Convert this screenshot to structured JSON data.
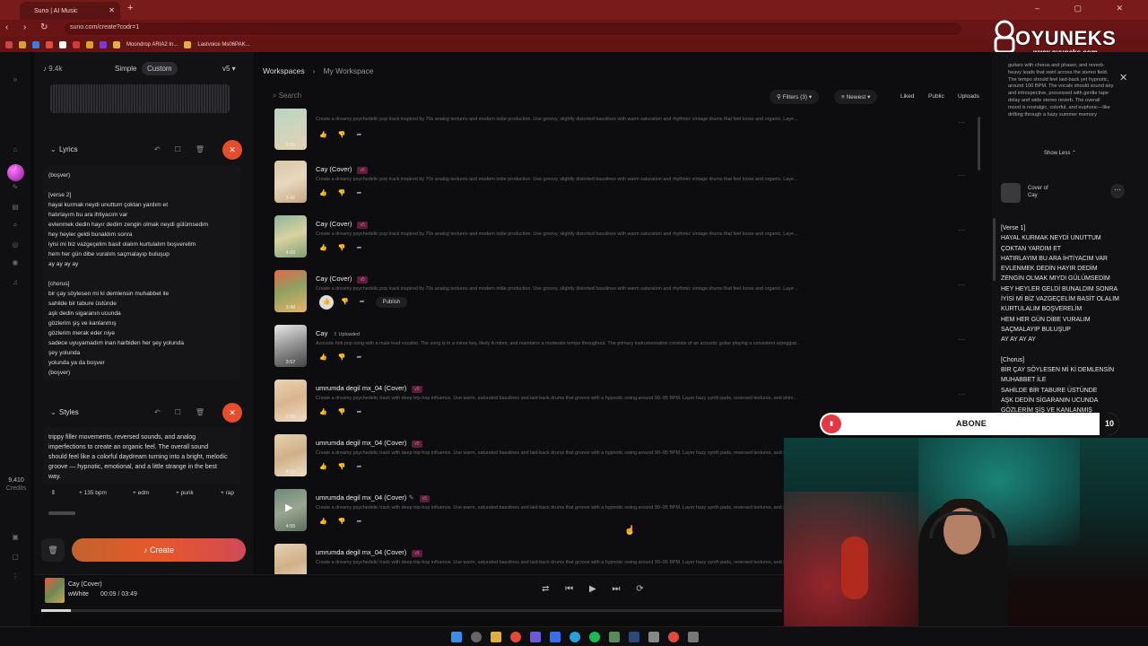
{
  "browser": {
    "tab_title": "Suno | AI Music",
    "url": "suno.com/create?codr=1",
    "bookmarks": [
      "Moondrop ARIA2 In...",
      "Lastvoice Ms06PAK..."
    ]
  },
  "overlay": {
    "brand": "OYUNEKS",
    "site": "www.oyuneks.com",
    "subscribe": "ABONE",
    "subscribe_count": "10"
  },
  "rail": {
    "credits_value": "9,410",
    "credits_label": "Credits"
  },
  "create_panel": {
    "likes": "9.4k",
    "mode_simple": "Simple",
    "mode_custom": "Custom",
    "version": "v5",
    "lyrics_label": "Lyrics",
    "lyrics_text": "(boşver)\n\n[verse 2]\nhayal kurmak neydi unuttum çoktan yardım et\nhatırlayım bu ara ihtiyacım var\nevlenmek dedin hayır dedim zengin olmak neydi gülümsedim\nhey heyler geldi bunaldım sonra\niyisi mi biz vazgeçelim basit olalım kurtulalım boşverelim\nhem her gün dibe vuralım saçmalayıp buluşup\nay ay ay ay\n\n[chorus]\nbir çay söylesen mi ki demlensin muhabbet ile\nsahilde bir tabure üstünde\naşk dedin sigaranın ucunda\ngözlerim şiş ve kanlanmış\ngözlerim merak eder niye\nsadece uyuyamadım inan harbiden her şey yolunda\nşey yolunda\nyolunda ya da boşver\n(boşver)",
    "styles_label": "Styles",
    "styles_text": "trippy filler movements, reversed sounds, and analog imperfections to create an organic feel. The overall sound should feel like a colorful daydream turning into a bright, melodic groove — hypnotic, emotional, and a little strange in the best way.",
    "tags": [
      "135 bpm",
      "edm",
      "punk",
      "rap"
    ],
    "create_label": "Create"
  },
  "workspace": {
    "crumb_root": "Workspaces",
    "crumb_current": "My Workspace",
    "search_placeholder": "Search",
    "filters": "Filters (3)",
    "sort": "Newest",
    "liked": "Liked",
    "public": "Public",
    "uploads": "Uploads",
    "rows": [
      {
        "title": "",
        "badge": "",
        "desc": "Create a dreamy psychedelic pop track inspired by 70s analog textures and modern indie production. Use groovy, slightly distorted basslines with warm saturation and rhythmic vintage drums that feel loose and organic. Laye...",
        "duration": "3:35"
      },
      {
        "title": "Cay (Cover)",
        "badge": "v5",
        "desc": "Create a dreamy psychedelic pop track inspired by 70s analog textures and modern indie production. Use groovy, slightly distorted basslines with warm saturation and rhythmic vintage drums that feel loose and organic. Laye...",
        "duration": "3:42"
      },
      {
        "title": "Cay (Cover)",
        "badge": "v5",
        "desc": "Create a dreamy psychedelic pop track inspired by 70s analog textures and modern indie production. Use groovy, slightly distorted basslines with warm saturation and rhythmic vintage drums that feel loose and organic. Laye...",
        "duration": "4:09"
      },
      {
        "title": "Cay (Cover)",
        "badge": "v5",
        "desc": "Create a dreamy psychedelic pop track inspired by 70s analog textures and modern indie production. Use groovy, slightly distorted basslines with warm saturation and rhythmic vintage drums that feel loose and organic. Laye...",
        "duration": "3:49",
        "publish": "Publish"
      },
      {
        "title": "Cay",
        "badge": "",
        "uploaded": "Uploaded",
        "desc": "Acoustic folk pop song with a male lead vocalist. The song is in a minor key, likely A minor, and maintains a moderate tempo throughout. The primary instrumentation consists of an acoustic guitar playing a consistent arpeggiat...",
        "duration": "3:57"
      },
      {
        "title": "umrumda degil mx_04 (Cover)",
        "badge": "v5",
        "desc": "Create a dreamy psychedelic track with deep trip-hop influence. Use warm, saturated basslines and laid-back drums that groove with a hypnotic swing around 90–95 BPM. Layer hazy synth pads, reversed textures, and shim...",
        "duration": "3:30"
      },
      {
        "title": "umrumda degil mx_04 (Cover)",
        "badge": "v5",
        "desc": "Create a dreamy psychedelic track with deep trip-hop influence. Use warm, saturated basslines and laid-back drums that groove with a hypnotic swing around 90–95 BPM. Layer hazy synth pads, reversed textures, and shim...",
        "duration": "4:54"
      },
      {
        "title": "umrumda degil mx_04 (Cover)",
        "badge": "v5",
        "desc": "Create a dreamy psychedelic track with deep trip-hop influence. Use warm, saturated basslines and laid-back drums that groove with a hypnotic swing around 90–95 BPM. Layer hazy synth pads, reversed textures, and shim...",
        "duration": "4:55"
      },
      {
        "title": "umrumda degil mx_04 (Cover)",
        "badge": "v5",
        "desc": "Create a dreamy psychedelic track with deep trip-hop influence. Use warm, saturated basslines and laid-back drums that groove with a hypnotic swing around 90–95 BPM. Layer hazy synth pads, reversed textures, and shim...",
        "duration": ""
      }
    ]
  },
  "detail": {
    "description": "guitars with chorus and phaser, and reverb-heavy leads that swirl across the stereo field. The tempo should feel laid-back yet hypnotic, around 100 BPM. The vocals should sound airy and introspective, processed with gentle tape delay and wide stereo reverb. The overall mood is nostalgic, colorful, and euphoric—like drifting through a hazy summer memory",
    "show_less": "Show Less",
    "cover_of": "Cover of",
    "cover_title": "Cay",
    "lyrics": "[Verse 1]\nHAYAL KURMAK NEYDİ UNUTTUM\nÇOKTAN YARDIM ET\nHATIRLAYIM BU ARA İHTİYACIM VAR\nEVLENMEK DEDİN HAYIR DEDİM\nZENGİN OLMAK MIYDI GÜLÜMSEDİM\nHEY HEYLER GELDİ BUNALDIM SONRA\nİYİSİ Mİ BİZ VAZGEÇELİM BASİT OLALIM\nKURTULALIM BOŞVERELİM\nHEM HER GÜN DİBE VURALIM\nSAÇMALAYIP BULUŞUP\nAY AY AY AY\n\n[Chorus]\nBİR ÇAY SÖYLESEN Mİ Kİ DEMLENSİN\nMUHABBET İLE\nSAHİLDE BİR TABURE ÜSTÜNDE\nAŞK DEDİN SİGARANIN UCUNDA\nGÖZLERİM ŞİŞ VE KANLANMIŞ\nGÖZLERİM MERAK EDER Mİ NİYE\nSADECE UYUYAMADIM İNAN"
  },
  "player": {
    "title": "Cay (Cover)",
    "artist": "wWhite",
    "time": "00:09 / 03:49",
    "progress": 0.04
  }
}
